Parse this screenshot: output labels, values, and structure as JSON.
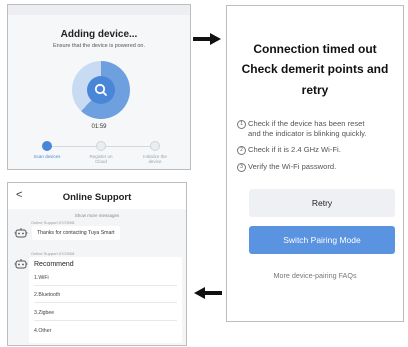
{
  "adding": {
    "title": "Adding device...",
    "subtitle": "Ensure that the device is powered on.",
    "timer": "01:59",
    "steps": [
      {
        "label": "Scan devices"
      },
      {
        "label": "Register on Cloud"
      },
      {
        "label": "Initialize the device"
      }
    ]
  },
  "timeout": {
    "title_line1": "Connection timed out",
    "title_line2": "Check demerit points and",
    "title_line3": "retry",
    "check1_line1": "Check if the device has been reset",
    "check1_line2": "and the indicator is blinking quickly.",
    "check2": "Check if it is 2.4 GHz Wi-Fi.",
    "check3": "Verify the Wi-Fi password.",
    "num1": "1",
    "num2": "2",
    "num3": "3",
    "retry_label": "Retry",
    "switch_label": "Switch Pairing Mode",
    "faq_label": "More device-pairing FAQs"
  },
  "support": {
    "back": "<",
    "title": "Online Support",
    "show_more": "Show more messages",
    "meta1": "Online Support  07/29/08",
    "message1": "Thanks for contacting Tuya Smart",
    "meta2": "Online Support  07/29/08",
    "recommend_title": "Recommend",
    "options": [
      "1.WiFi",
      "2.Bluetooth",
      "3.Zigbee",
      "4.Other"
    ]
  },
  "colors": {
    "accent": "#4a86d8",
    "button_primary": "#5a93e0",
    "button_secondary": "#eef0f3"
  }
}
